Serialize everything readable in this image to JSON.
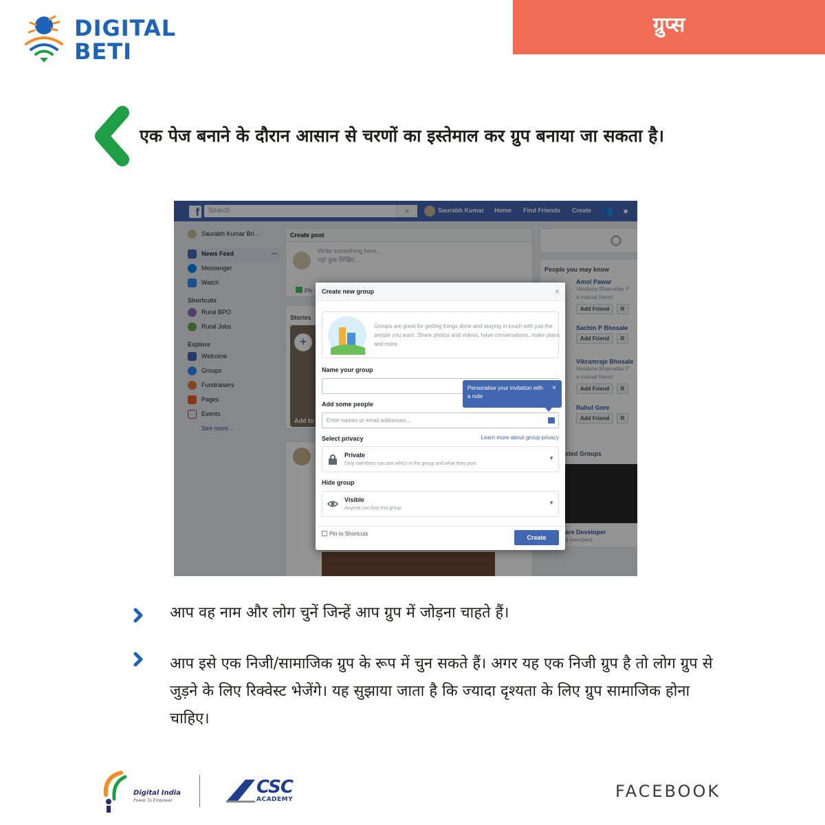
{
  "brand": {
    "line1": "DIGITAL",
    "line2": "BETI"
  },
  "topic_tab": "ग्रुप्स",
  "heading": "एक पेज बनाने के दौरान आसान से चरणों का इस्तेमाल कर ग्रुप बनाया जा सकता है।",
  "screenshot": {
    "topbar": {
      "search_placeholder": "Search",
      "user": "Saurabh Kumar",
      "nav": [
        "Home",
        "Find Friends",
        "Create"
      ]
    },
    "left_nav": {
      "profile": "Saurabh Kumar Bri...",
      "main": [
        "News Feed",
        "Messenger",
        "Watch"
      ],
      "shortcuts_title": "Shortcuts",
      "shortcuts": [
        "Rural BPO",
        "Rural Jobs"
      ],
      "explore_title": "Explore",
      "explore": [
        "Welcome",
        "Groups",
        "Fundraisers",
        "Pages",
        "Events"
      ],
      "see_more": "See more..."
    },
    "center": {
      "create_post_title": "Create post",
      "post_placeholder_en": "Write something here...",
      "post_placeholder_hi": "यहां कुछ लिखिए...",
      "photo_label": "Ph",
      "stories_title": "Stories",
      "add_story": "Add to"
    },
    "right": {
      "pymk_title": "People you may know",
      "people": [
        {
          "name": "Amol Pawar",
          "sub1": "Vandana Bhanudas P",
          "sub2": "a mutual friend"
        },
        {
          "name": "Sachin P Bhosale",
          "sub1": "",
          "sub2": ""
        },
        {
          "name": "Vikramraje Bhosale",
          "sub1": "Vandana Bhanudas P",
          "sub2": "a mutual friend"
        },
        {
          "name": "Rahul Gore",
          "sub1": "",
          "sub2": ""
        }
      ],
      "add_friend": "Add Friend",
      "remove_short": "R",
      "suggested_groups": "sted Groups",
      "group_name": "are Developer",
      "group_members": "6 members"
    },
    "modal": {
      "title": "Create new group",
      "intro": "Groups are great for getting things done and staying in touch with just the people you want. Share photos and videos, have conversations, make plans and more.",
      "name_label": "Name your group",
      "people_label": "Add some people",
      "people_placeholder": "Enter names or email addresses...",
      "privacy_label": "Select privacy",
      "privacy_link": "Learn more about group privacy",
      "privacy_title": "Private",
      "privacy_desc": "Only members can see who's in the group and what they post",
      "hide_label": "Hide group",
      "hide_title": "Visible",
      "hide_desc": "Anyone can find this group",
      "pin_label": "Pin to Shortcuts",
      "create_button": "Create",
      "tooltip": "Personalise your invitation with a note"
    }
  },
  "bullets": [
    "आप वह नाम और लोग चुनें जिन्हें आप ग्रुप में जोड़ना चाहते हैं।",
    "आप इसे एक निजी/सामाजिक ग्रुप के रूप में चुन सकते हैं। अगर यह एक निजी ग्रुप है तो लोग ग्रुप से जुड़ने के लिए रिक्वेस्ट भेजेंगे। यह सुझाया जाता है कि ज्यादा दृश्यता के लिए ग्रुप सामाजिक होना चाहिए।"
  ],
  "footer": {
    "digital_india": "Digital India",
    "digital_india_tag": "Power To Empower",
    "csc": "CSC",
    "csc_sub": "ACADEMY",
    "label": "FACEBOOK"
  },
  "colors": {
    "brand_blue": "#1d63b8",
    "tab_orange": "#f06c55",
    "chevron_green": "#1e9e45",
    "bullet_blue": "#1d63b8",
    "fb_blue": "#4267b2"
  }
}
